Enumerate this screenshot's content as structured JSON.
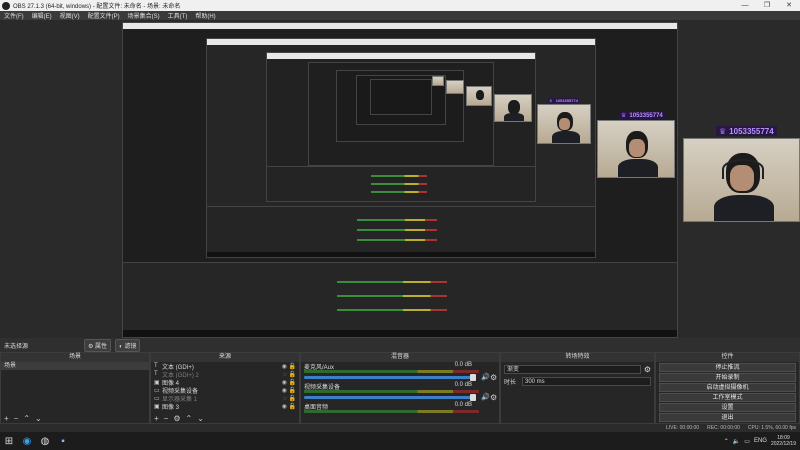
{
  "window": {
    "title": "OBS 27.1.3 (64-bit, windows) - 配置文件: 未命名 - 场景: 未命名",
    "minimize": "—",
    "maximize": "❐",
    "close": "✕"
  },
  "menu": [
    "文件(F)",
    "编辑(E)",
    "视图(V)",
    "配置文件(P)",
    "场景集合(S)",
    "工具(T)",
    "帮助(H)"
  ],
  "preview": {
    "badge_text": "1053355774",
    "badge_icon": "crown-icon"
  },
  "toolbar": {
    "label": "未选择源",
    "properties": "属性",
    "filters": "滤镜"
  },
  "scenes": {
    "header": "场景",
    "items": [
      "场景"
    ]
  },
  "sources": {
    "header": "来源",
    "items": [
      {
        "icon": "text-icon",
        "name": "文本 (GDI+)",
        "dim": false
      },
      {
        "icon": "text-icon",
        "name": "文本 (GDI+) 2",
        "dim": true
      },
      {
        "icon": "image-icon",
        "name": "图像 4",
        "dim": false
      },
      {
        "icon": "camera-icon",
        "name": "视频采集设备",
        "dim": false
      },
      {
        "icon": "display-icon",
        "name": "显示器采集 1",
        "dim": true
      },
      {
        "icon": "image-icon",
        "name": "图像 3",
        "dim": false
      }
    ]
  },
  "mixer": {
    "header": "混音器",
    "tracks": [
      {
        "name": "麦克风/Aux",
        "db": "0.0 dB"
      },
      {
        "name": "视频采集设备",
        "db": "0.0 dB"
      },
      {
        "name": "桌面音频",
        "db": "0.0 dB"
      }
    ]
  },
  "transitions": {
    "header": "转场特效",
    "type": "渐变",
    "duration_label": "时长",
    "duration_value": "300 ms"
  },
  "controls": {
    "header": "控件",
    "buttons": [
      "停止推流",
      "开始录制",
      "启动虚拟摄像机",
      "工作室模式",
      "设置",
      "退出"
    ]
  },
  "status": {
    "live": "LIVE: 00:00:00",
    "rec": "REC: 00:00:00",
    "cpu": "CPU: 1.5%, 60.00 fps"
  },
  "taskbar": {
    "lang": "ENG",
    "time": "18:09",
    "date": "2022/12/19"
  },
  "colors": {
    "badge_text": "#b693ff",
    "accent_slider": "#3b80c7"
  }
}
